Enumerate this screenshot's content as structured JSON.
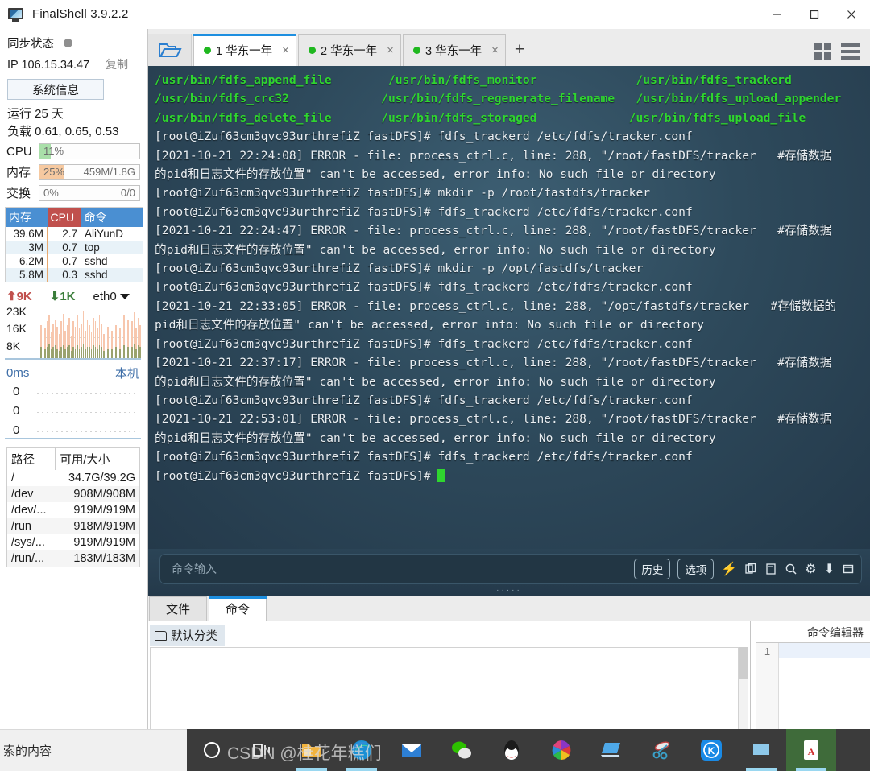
{
  "window": {
    "title": "FinalShell 3.9.2.2",
    "app_icon": "monitor-icon",
    "minimize": "minimize-icon",
    "maximize": "maximize-icon",
    "close": "close-icon"
  },
  "sidebar": {
    "sync_status_label": "同步状态",
    "sync_status_dot_color": "#8f8f8f",
    "ip_label": "IP 106.15.34.47",
    "copy_label": "复制",
    "system_info_button": "系统信息",
    "uptime": "运行 25 天",
    "load": "负载 0.61, 0.65, 0.53",
    "meters": [
      {
        "name": "CPU",
        "percent": "11%",
        "percent_value": 11,
        "right": "",
        "fill": "#a9dfa9"
      },
      {
        "name": "内存",
        "percent": "25%",
        "percent_value": 25,
        "right": "459M/1.8G",
        "fill": "#f6c9a0"
      },
      {
        "name": "交换",
        "percent": "0%",
        "percent_value": 0,
        "right": "0/0",
        "fill": "#f6c9a0"
      }
    ],
    "process_table": {
      "headers": [
        "内存",
        "CPU",
        "命令"
      ],
      "rows": [
        [
          "39.6M",
          "2.7",
          "AliYunD"
        ],
        [
          "3M",
          "0.7",
          "top"
        ],
        [
          "6.2M",
          "0.7",
          "sshd"
        ],
        [
          "5.8M",
          "0.3",
          "sshd"
        ]
      ]
    },
    "network": {
      "upload": "9K",
      "download": "1K",
      "interface": "eth0",
      "up_arrow": "arrow-up-icon",
      "down_arrow": "arrow-down-icon",
      "y_labels": [
        "23K",
        "16K",
        "8K"
      ],
      "upload_series": [
        18,
        22,
        16,
        20,
        23,
        14,
        19,
        21,
        17,
        13,
        20,
        24,
        15,
        18,
        22,
        12,
        20,
        17,
        23,
        16,
        19,
        26,
        15,
        21,
        18,
        14,
        22,
        20,
        16,
        23,
        19,
        13,
        21,
        17,
        24,
        15,
        20,
        18,
        22,
        16,
        19,
        23,
        14,
        21,
        17,
        20,
        25,
        16,
        22,
        18
      ],
      "download_series": [
        6,
        7,
        5,
        6,
        8,
        5,
        6,
        7,
        5,
        4,
        6,
        7,
        5,
        6,
        7,
        4,
        6,
        5,
        7,
        5,
        6,
        8,
        5,
        6,
        6,
        5,
        7,
        6,
        5,
        7,
        6,
        4,
        6,
        5,
        7,
        5,
        6,
        6,
        7,
        5,
        6,
        7,
        4,
        6,
        5,
        6,
        8,
        5,
        7,
        6
      ]
    },
    "ping": {
      "latency": "0ms",
      "host_label": "本机",
      "y_labels": [
        "0",
        "0",
        "0"
      ]
    },
    "disk_table": {
      "headers": [
        "路径",
        "可用/大小"
      ],
      "rows": [
        [
          "/",
          "34.7G/39.2G"
        ],
        [
          "/dev",
          "908M/908M"
        ],
        [
          "/dev/...",
          "919M/919M"
        ],
        [
          "/run",
          "918M/919M"
        ],
        [
          "/sys/...",
          "919M/919M"
        ],
        [
          "/run/...",
          "183M/183M"
        ]
      ]
    }
  },
  "tabbar": {
    "folder_button": "open-folder-icon",
    "tabs": [
      {
        "index": "1",
        "name": "华东一年",
        "active": true
      },
      {
        "index": "2",
        "name": "华东一年",
        "active": false
      },
      {
        "index": "3",
        "name": "华东一年",
        "active": false
      }
    ],
    "add_tab": "+",
    "grid_view": "grid-view-icon",
    "menu": "hamburger-menu-icon"
  },
  "terminal": {
    "lines": [
      {
        "t": "green",
        "text": "/usr/bin/fdfs_append_file        /usr/bin/fdfs_monitor              /usr/bin/fdfs_trackerd"
      },
      {
        "t": "green",
        "text": "/usr/bin/fdfs_crc32             /usr/bin/fdfs_regenerate_filename   /usr/bin/fdfs_upload_appender"
      },
      {
        "t": "green",
        "text": "/usr/bin/fdfs_delete_file       /usr/bin/fdfs_storaged             /usr/bin/fdfs_upload_file"
      },
      {
        "t": "plain",
        "text": "[root@iZuf63cm3qvc93urthrefiZ fastDFS]# fdfs_trackerd /etc/fdfs/tracker.conf"
      },
      {
        "t": "plain",
        "text": "[2021-10-21 22:24:08] ERROR - file: process_ctrl.c, line: 288, \"/root/fastDFS/tracker   #存储数据"
      },
      {
        "t": "plain",
        "text": "的pid和日志文件的存放位置\" can't be accessed, error info: No such file or directory"
      },
      {
        "t": "plain",
        "text": "[root@iZuf63cm3qvc93urthrefiZ fastDFS]# mkdir -p /root/fastdfs/tracker"
      },
      {
        "t": "plain",
        "text": "[root@iZuf63cm3qvc93urthrefiZ fastDFS]# fdfs_trackerd /etc/fdfs/tracker.conf"
      },
      {
        "t": "plain",
        "text": "[2021-10-21 22:24:47] ERROR - file: process_ctrl.c, line: 288, \"/root/fastDFS/tracker   #存储数据"
      },
      {
        "t": "plain",
        "text": "的pid和日志文件的存放位置\" can't be accessed, error info: No such file or directory"
      },
      {
        "t": "plain",
        "text": "[root@iZuf63cm3qvc93urthrefiZ fastDFS]# mkdir -p /opt/fastdfs/tracker"
      },
      {
        "t": "plain",
        "text": "[root@iZuf63cm3qvc93urthrefiZ fastDFS]# fdfs_trackerd /etc/fdfs/tracker.conf"
      },
      {
        "t": "plain",
        "text": "[2021-10-21 22:33:05] ERROR - file: process_ctrl.c, line: 288, \"/opt/fastdfs/tracker   #存储数据的"
      },
      {
        "t": "plain",
        "text": "pid和日志文件的存放位置\" can't be accessed, error info: No such file or directory"
      },
      {
        "t": "plain",
        "text": "[root@iZuf63cm3qvc93urthrefiZ fastDFS]# fdfs_trackerd /etc/fdfs/tracker.conf"
      },
      {
        "t": "plain",
        "text": "[2021-10-21 22:37:17] ERROR - file: process_ctrl.c, line: 288, \"/root/fastDFS/tracker   #存储数据"
      },
      {
        "t": "plain",
        "text": "的pid和日志文件的存放位置\" can't be accessed, error info: No such file or directory"
      },
      {
        "t": "plain",
        "text": "[root@iZuf63cm3qvc93urthrefiZ fastDFS]# fdfs_trackerd /etc/fdfs/tracker.conf"
      },
      {
        "t": "plain",
        "text": "[2021-10-21 22:53:01] ERROR - file: process_ctrl.c, line: 288, \"/root/fastDFS/tracker   #存储数据"
      },
      {
        "t": "plain",
        "text": "的pid和日志文件的存放位置\" can't be accessed, error info: No such file or directory"
      },
      {
        "t": "plain",
        "text": "[root@iZuf63cm3qvc93urthrefiZ fastDFS]# fdfs_trackerd /etc/fdfs/tracker.conf"
      },
      {
        "t": "prompt",
        "text": "[root@iZuf63cm3qvc93urthrefiZ fastDFS]# "
      }
    ]
  },
  "command_bar": {
    "placeholder": "命令输入",
    "history_button": "历史",
    "options_button": "选项",
    "icons": [
      "bolt-icon",
      "copy-icon",
      "paste-icon",
      "search-icon",
      "gear-icon",
      "download-icon",
      "window-icon"
    ]
  },
  "lower_panel": {
    "tabs": [
      {
        "label": "文件",
        "active": false
      },
      {
        "label": "命令",
        "active": true
      }
    ],
    "category_chip": "默认分类",
    "category_icon": "folder-icon",
    "editor_title": "命令编辑器",
    "editor_line_number": "1"
  },
  "taskbar": {
    "search_text": "索的内容",
    "items": [
      {
        "name": "cortana-icon"
      },
      {
        "name": "task-view-icon"
      },
      {
        "name": "file-explorer-icon"
      },
      {
        "name": "edge-browser-icon"
      },
      {
        "name": "mail-icon"
      },
      {
        "name": "wechat-icon"
      },
      {
        "name": "qq-icon"
      },
      {
        "name": "360-browser-icon"
      },
      {
        "name": "remote-desktop-icon"
      },
      {
        "name": "snipping-tool-icon"
      },
      {
        "name": "kingsoft-icon"
      },
      {
        "name": "finalshell-icon"
      },
      {
        "name": "pdf-reader-icon"
      }
    ],
    "watermark": "CSDN @桂花年糕们"
  }
}
